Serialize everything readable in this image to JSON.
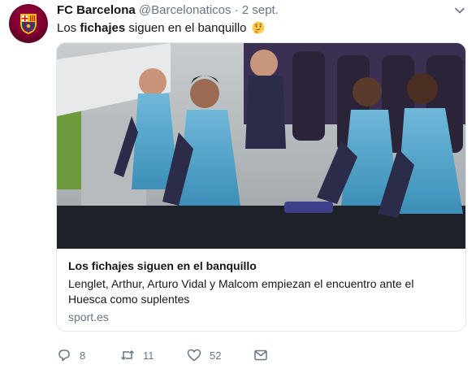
{
  "tweet": {
    "name": "FC Barcelona",
    "handle": "@Barcelonaticos",
    "separator": "·",
    "date": "2 sept.",
    "text_before": "Los ",
    "text_bold": "fichajes",
    "text_after": " siguen en el banquillo",
    "emoji_icon": "thinking-face-icon"
  },
  "card": {
    "title": "Los fichajes siguen en el banquillo",
    "description": "Lenglet, Arthur, Arturo Vidal y Malcom empiezan el encuentro ante el Huesca como suplentes",
    "domain": "sport.es"
  },
  "actions": {
    "replies": "8",
    "retweets": "11",
    "likes": "52"
  },
  "colors": {
    "text": "#14171a",
    "muted": "#657786",
    "border": "#e1e8ed",
    "bib": "#4fa3c9",
    "barca_blaugrana": "#a50044"
  }
}
